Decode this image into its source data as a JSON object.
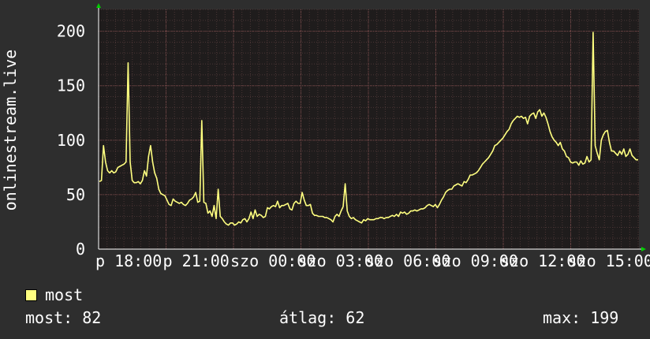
{
  "chart_data": {
    "type": "line",
    "ylabel": "onlinestream.live",
    "ylim": [
      0,
      220
    ],
    "yticks": [
      0,
      50,
      100,
      150,
      200
    ],
    "xticklabels": [
      "p 18:00",
      "p 21:00",
      "szo 00:00",
      "szo 03:00",
      "szo 06:00",
      "szo 09:00",
      "szo 12:00",
      "szo 15:00"
    ],
    "grid": true,
    "series": [
      {
        "name": "most",
        "color": "#ffff80",
        "values": [
          62,
          63,
          95,
          80,
          72,
          70,
          72,
          70,
          71,
          75,
          76,
          77,
          78,
          80,
          171,
          80,
          63,
          61,
          61,
          62,
          60,
          63,
          72,
          67,
          85,
          95,
          80,
          70,
          65,
          55,
          51,
          50,
          49,
          45,
          41,
          40,
          46,
          44,
          43,
          42,
          43,
          41,
          40,
          42,
          45,
          46,
          48,
          52,
          43,
          44,
          118,
          43,
          42,
          33,
          35,
          30,
          40,
          28,
          55,
          30,
          28,
          25,
          23,
          22,
          24,
          24,
          22,
          23,
          25,
          24,
          27,
          28,
          25,
          28,
          34,
          28,
          36,
          30,
          32,
          31,
          29,
          30,
          38,
          37,
          39,
          40,
          39,
          44,
          38,
          40,
          40,
          41,
          42,
          37,
          36,
          42,
          44,
          42,
          42,
          52,
          45,
          40,
          40,
          41,
          33,
          31,
          31,
          30,
          30,
          30,
          29,
          29,
          28,
          27,
          25,
          30,
          32,
          30,
          35,
          39,
          60,
          35,
          30,
          28,
          29,
          27,
          26,
          25,
          24,
          27,
          26,
          28,
          27,
          27,
          27,
          28,
          28,
          29,
          29,
          28,
          29,
          29,
          30,
          31,
          30,
          32,
          30,
          34,
          33,
          34,
          32,
          33,
          35,
          35,
          36,
          35,
          36,
          37,
          37,
          38,
          40,
          41,
          40,
          39,
          41,
          38,
          41,
          45,
          48,
          52,
          54,
          55,
          55,
          58,
          59,
          60,
          59,
          58,
          62,
          61,
          64,
          68,
          68,
          69,
          70,
          72,
          75,
          78,
          80,
          82,
          84,
          87,
          90,
          95,
          96,
          98,
          100,
          102,
          105,
          108,
          110,
          115,
          118,
          120,
          122,
          121,
          122,
          120,
          121,
          115,
          122,
          124,
          125,
          120,
          126,
          128,
          122,
          125,
          121,
          115,
          108,
          103,
          100,
          98,
          95,
          98,
          92,
          90,
          85,
          84,
          80,
          79,
          80,
          80,
          77,
          81,
          78,
          79,
          85,
          80,
          82,
          199,
          95,
          88,
          82,
          100,
          105,
          108,
          109,
          98,
          90,
          90,
          88,
          86,
          90,
          87,
          92,
          85,
          87,
          92,
          86,
          84,
          82,
          82
        ]
      }
    ],
    "stats": {
      "current": 82,
      "average": 62,
      "max": 199
    }
  },
  "labels": {
    "ylabel": "onlinestream.live",
    "legend_name": "most",
    "current": "most: 82",
    "average": "átlag: 62",
    "max": "max: 199"
  }
}
